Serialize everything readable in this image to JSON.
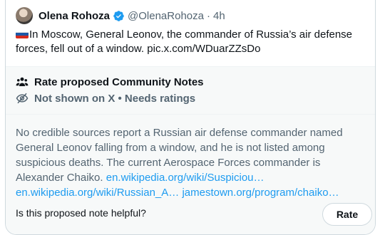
{
  "tweet": {
    "author_name": "Olena Rohoza",
    "handle": "@OlenaRohoza",
    "separator": "·",
    "time": "4h",
    "text": "In Moscow, General Leonov, the commander of Russia’s air defense forces, fell out of a window. pic.x.com/WDuarZZsDo",
    "flag_colors": [
      "#ffffff",
      "#1c57a7",
      "#d52b1e"
    ]
  },
  "community_notes": {
    "header_label": "Rate proposed Community Notes",
    "status_label": "Not shown on X • Needs ratings",
    "note_body": "No credible sources report a Russian air defense commander named General Leonov falling from a window, and he is not listed among suspicious deaths. The current Aerospace Forces commander is Alexander Chaiko. ",
    "links": [
      "en.wikipedia.org/wiki/Suspiciou…",
      "en.wikipedia.org/wiki/Russian_A…",
      "jamestown.org/program/chaiko…"
    ],
    "helpful_question": "Is this proposed note helpful?",
    "rate_button": "Rate"
  },
  "colors": {
    "link": "#1d9bf0",
    "verified": "#1d9bf0",
    "muted": "#536471"
  }
}
